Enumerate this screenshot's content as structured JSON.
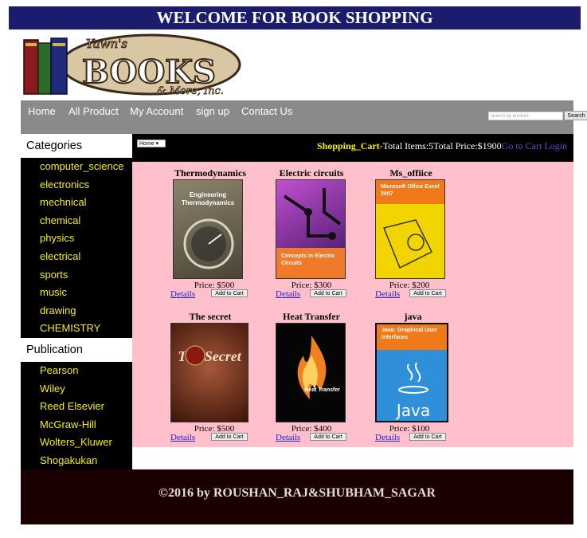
{
  "banner": {
    "title": "WELCOME FOR BOOK SHOPPING"
  },
  "logo": {
    "text_main": "BOOKS",
    "text_top": "Yawn's",
    "text_bottom": "& More, Inc."
  },
  "nav": {
    "items": [
      "Home",
      "All Product",
      "My Account",
      "sign up",
      "Contact Us"
    ],
    "search_placeholder": "search by product",
    "search_label": "Search"
  },
  "sidebar": {
    "categories_title": "Categories",
    "categories": [
      "computer_science",
      "electronics",
      "mechnical",
      "chemical",
      "physics",
      "electrical",
      "sports",
      "music",
      "drawing",
      "CHEMISTRY"
    ],
    "publication_title": "Publication",
    "publications": [
      "Pearson",
      "Wiley",
      "Reed Elsevier",
      "McGraw-Hill",
      "Wolters_Kluwer",
      "Shogakukan"
    ]
  },
  "cartbar": {
    "home_select": "Home",
    "cart_label": "Shopping_Cart",
    "total_items_text": "-Total Items:5",
    "total_price_text": "Total Price:$1900",
    "goto_cart": "Go to Cart",
    "login": "Login"
  },
  "products": [
    {
      "title": "Thermodynamics",
      "price": "Price: $500",
      "details": "Details",
      "add": "Add to Cart",
      "cover_text": "Engineering Thermodynamics",
      "cover_color": "#6b6250"
    },
    {
      "title": "Electric circuits",
      "price": "Price: $300",
      "details": "Details",
      "add": "Add to Cart",
      "cover_text": "Concepts in Electric Circuits",
      "cover_color": "#8a2a8c"
    },
    {
      "title": "Ms_offiice",
      "price": "Price: $200",
      "details": "Details",
      "add": "Add to Cart",
      "cover_text": "Microsoft Office Excel 2007",
      "cover_color": "#f2d400"
    },
    {
      "title": "The secret",
      "price": "Price: $500",
      "details": "Details",
      "add": "Add to Cart",
      "cover_text": "The Secret",
      "cover_color": "#5a2a1c"
    },
    {
      "title": "Heat Transfer",
      "price": "Price: $400",
      "details": "Details",
      "add": "Add to Cart",
      "cover_text": "Heat Transfer",
      "cover_color": "#0a0a0a"
    },
    {
      "title": "java",
      "price": "Price: $100",
      "details": "Details",
      "add": "Add to Cart",
      "cover_text": "Java: Graphical User Interfaces",
      "cover_color": "#2f8fd8"
    }
  ],
  "footer": {
    "text": "©2016 by ROUSHAN_RAJ&SHUBHAM_SAGAR"
  }
}
